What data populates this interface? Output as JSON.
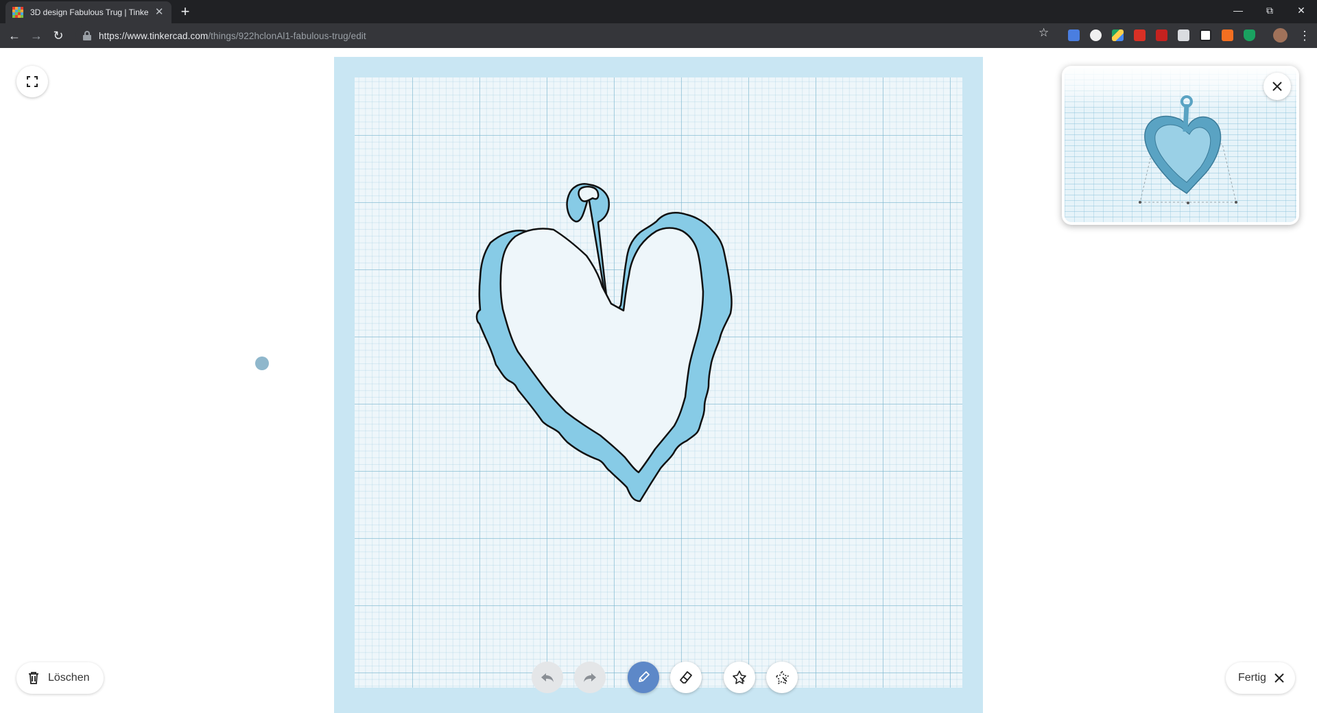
{
  "browser": {
    "tab_title": "3D design Fabulous Trug | Tinkercad",
    "tab_close_icon": "close-icon",
    "new_tab_icon": "plus-icon",
    "url_host": "https://www.tinkercad.com",
    "url_path": "/things/922hclonAl1-fabulous-trug/edit",
    "window_controls": [
      "minimize-icon",
      "restore-icon",
      "close-icon"
    ]
  },
  "app": {
    "delete_label": "Löschen",
    "done_label": "Fertig",
    "tools": [
      "undo-icon",
      "redo-icon",
      "pencil-icon",
      "eraser-icon",
      "shape-select-icon",
      "shape-select-subtract-icon"
    ],
    "accent_color": "#5d88c8",
    "shape_fill": "#87cbe6",
    "grid_color": "#c9e6f3"
  }
}
